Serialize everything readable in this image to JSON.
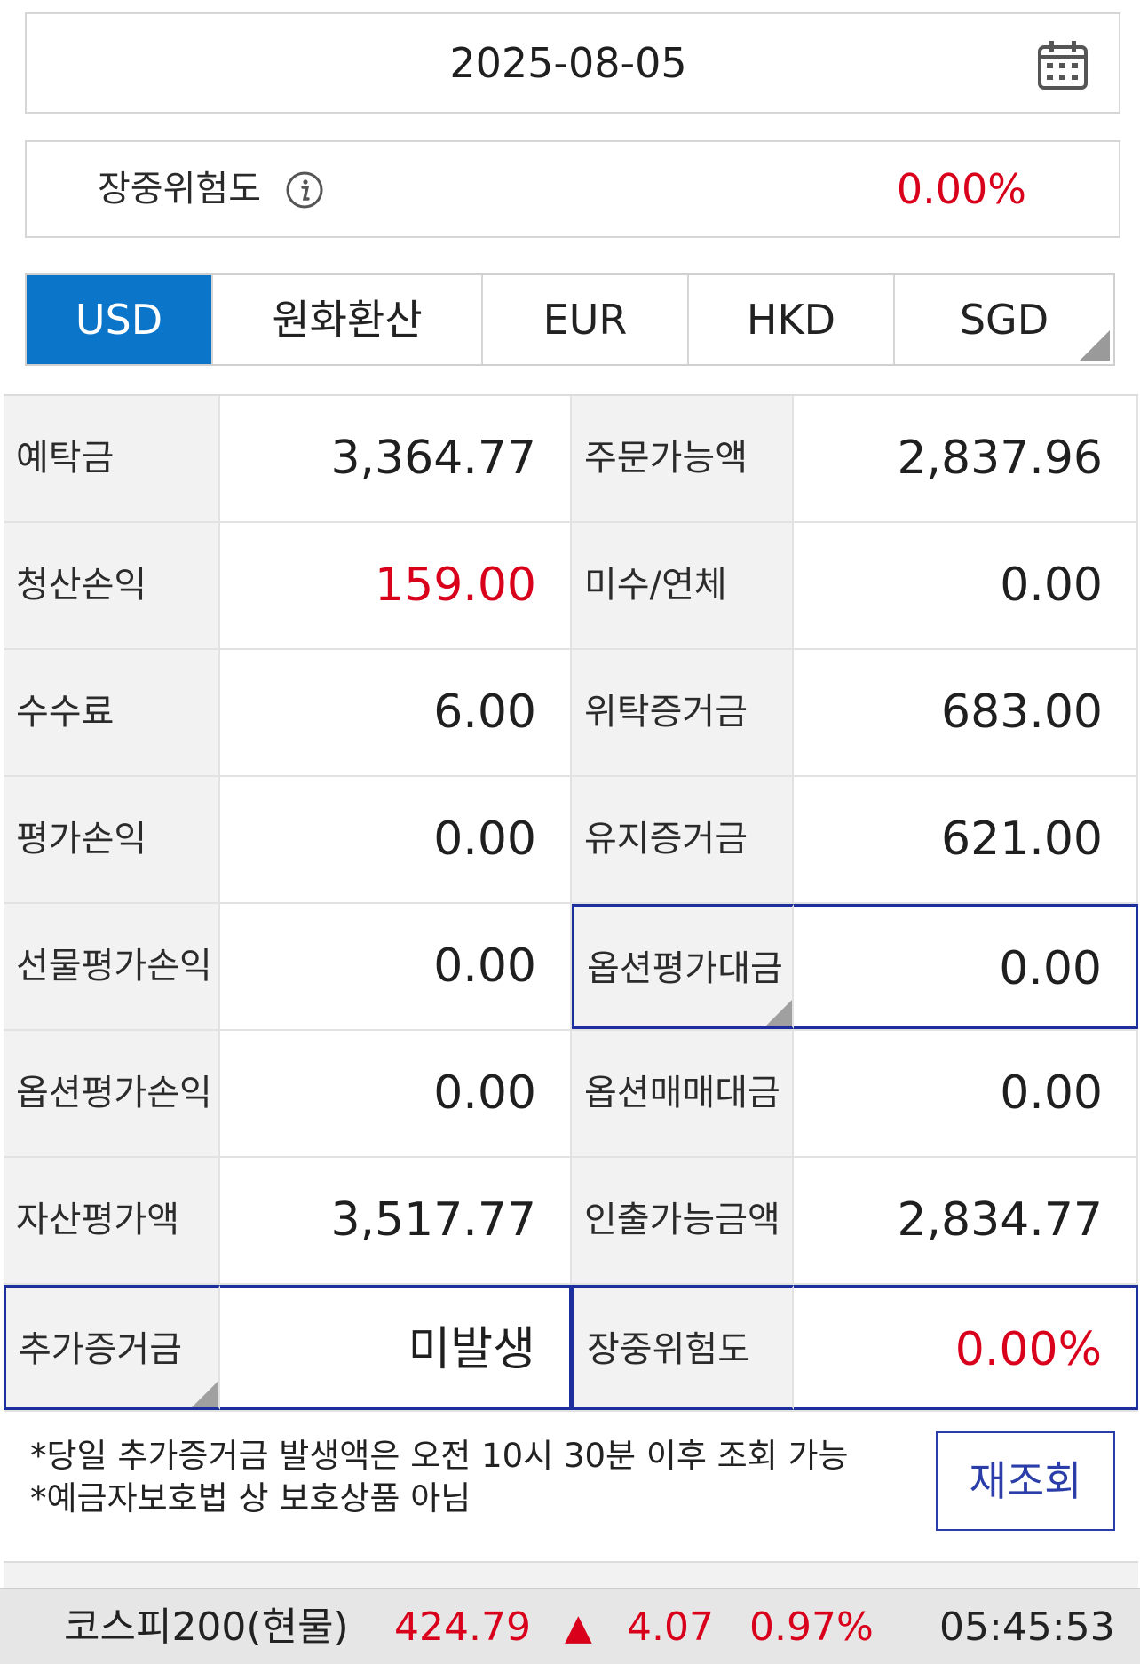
{
  "date_picker": {
    "value": "2025-08-05",
    "icon": "calendar-icon"
  },
  "risk_summary": {
    "label": "장중위험도",
    "value": "0.00%",
    "icon": "info-icon"
  },
  "currency_tabs": [
    {
      "label": "USD",
      "active": true
    },
    {
      "label": "원화환산",
      "active": false
    },
    {
      "label": "EUR",
      "active": false
    },
    {
      "label": "HKD",
      "active": false
    },
    {
      "label": "SGD",
      "active": false
    }
  ],
  "account": {
    "rows": [
      {
        "l1": "예탁금",
        "v1": "3,364.77",
        "l2": "주문가능액",
        "v2": "2,837.96"
      },
      {
        "l1": "청산손익",
        "v1": "159.00",
        "l2": "미수/연체",
        "v2": "0.00"
      },
      {
        "l1": "수수료",
        "v1": "6.00",
        "l2": "위탁증거금",
        "v2": "683.00"
      },
      {
        "l1": "평가손익",
        "v1": "0.00",
        "l2": "유지증거금",
        "v2": "621.00"
      },
      {
        "l1": "선물평가손익",
        "v1": "0.00",
        "l2": "옵션평가대금",
        "v2": "0.00"
      },
      {
        "l1": "옵션평가손익",
        "v1": "0.00",
        "l2": "옵션매매대금",
        "v2": "0.00"
      },
      {
        "l1": "자산평가액",
        "v1": "3,517.77",
        "l2": "인출가능금액",
        "v2": "2,834.77"
      },
      {
        "l1": "추가증거금",
        "v1": "미발생",
        "l2": "장중위험도",
        "v2": "0.00%"
      }
    ]
  },
  "notes": [
    "*당일 추가증거금 발생액은 오전 10시 30분 이후 조회 가능",
    "*예금자보호법 상 보호상품 아님"
  ],
  "refresh_button": "재조회",
  "colors": {
    "accent": "#0b76c9",
    "negative_red": "#d9001b",
    "highlight_border": "#1d2f9c"
  },
  "ticker": {
    "name": "코스피200(현물)",
    "price": "424.79",
    "direction": "▲",
    "change": "4.07",
    "percent": "0.97%",
    "time": "05:45:53"
  }
}
